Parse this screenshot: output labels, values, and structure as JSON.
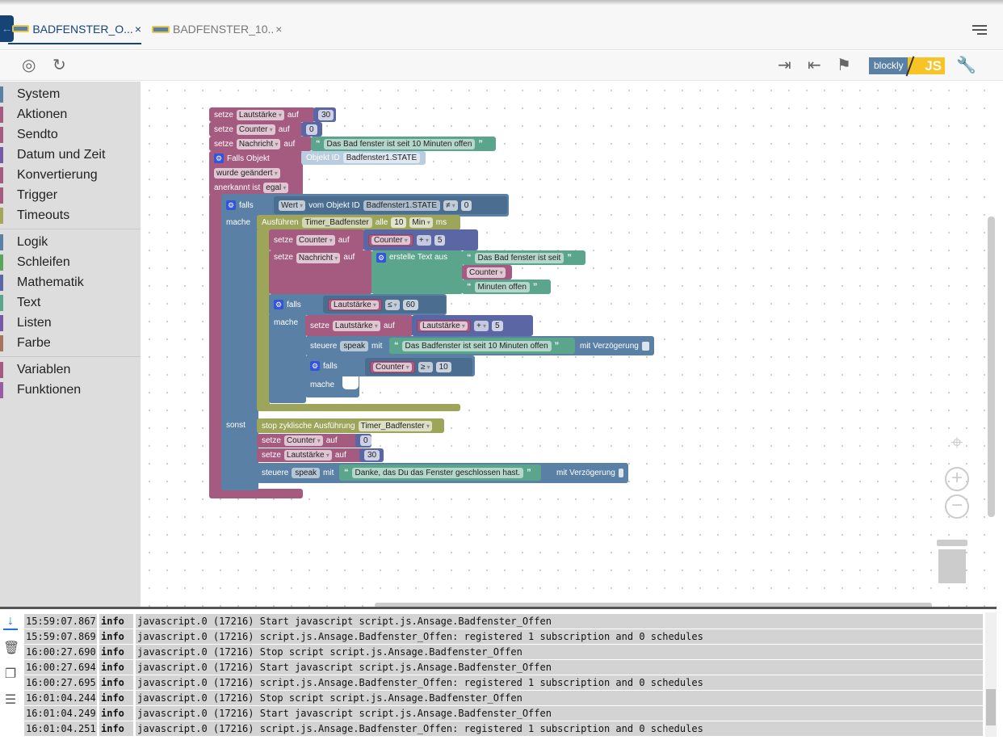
{
  "tabs": [
    {
      "label": "BADFENSTER_O...",
      "active": true
    },
    {
      "label": "BADFENSTER_10..",
      "active": false
    }
  ],
  "toolbar": {
    "logo_blockly": "blockly",
    "logo_js": "JS"
  },
  "sidebar": {
    "items": [
      {
        "label": "System",
        "color": "#5b80a5"
      },
      {
        "label": "Aktionen",
        "color": "#a55b80"
      },
      {
        "label": "Sendto",
        "color": "#a55b80"
      },
      {
        "label": "Datum und Zeit",
        "color": "#745ba5"
      },
      {
        "label": "Konvertierung",
        "color": "#a55b80"
      },
      {
        "label": "Trigger",
        "color": "#a55b80"
      },
      {
        "label": "Timeouts",
        "color": "#a5a55b"
      },
      {
        "label": "Logik",
        "color": "#5b80a5"
      },
      {
        "label": "Schleifen",
        "color": "#5ba55b"
      },
      {
        "label": "Mathematik",
        "color": "#5b67a5"
      },
      {
        "label": "Text",
        "color": "#5ba58c"
      },
      {
        "label": "Listen",
        "color": "#745ba5"
      },
      {
        "label": "Farbe",
        "color": "#a5745b"
      },
      {
        "label": "Variablen",
        "color": "#a55b80"
      },
      {
        "label": "Funktionen",
        "color": "#995ba5"
      }
    ]
  },
  "colors": {
    "variable": "#a55b80",
    "math": "#5b67a5",
    "text": "#5ba58c",
    "logic": "#5b80a5",
    "timer": "#9da55b",
    "object": "#b9cde0",
    "accent": "#164477"
  },
  "blocks": {
    "b1": [
      [
        "L",
        "setze"
      ],
      [
        "D",
        "Lautstärke"
      ],
      [
        "L",
        "auf"
      ]
    ],
    "b1v": [
      [
        "N",
        "30"
      ]
    ],
    "b2": [
      [
        "L",
        "setze"
      ],
      [
        "D",
        "Counter"
      ],
      [
        "L",
        "auf"
      ]
    ],
    "b2v": [
      [
        "N",
        "0"
      ]
    ],
    "b3": [
      [
        "L",
        "setze"
      ],
      [
        "D",
        "Nachricht"
      ],
      [
        "L",
        "auf"
      ]
    ],
    "b3v": [
      [
        "Q",
        "“"
      ],
      [
        "S",
        "Das Bad fenster ist seit 10 Minuten offen"
      ],
      [
        "Q",
        "”"
      ]
    ],
    "b4a": [
      [
        "G",
        "⚙"
      ],
      [
        "L",
        "Falls Objekt"
      ]
    ],
    "b4b": [
      [
        "D",
        "wurde geändert"
      ]
    ],
    "b4c": [
      [
        "L",
        "anerkannt ist"
      ],
      [
        "D",
        "egal"
      ]
    ],
    "b4obj": [
      [
        "L",
        "Objekt ID"
      ],
      [
        "S",
        "Badfenster1.STATE"
      ]
    ],
    "b5": [
      [
        "G",
        "⚙"
      ],
      [
        "L",
        "falls"
      ]
    ],
    "b5cond": [
      [
        "D",
        "Wert"
      ],
      [
        "L",
        "vom Objekt ID"
      ],
      [
        "S",
        "Badfenster1.STATE"
      ],
      [
        "D",
        "≠"
      ],
      [
        "N",
        "0"
      ]
    ],
    "b5m": [
      [
        "L",
        "mache"
      ]
    ],
    "b5s": [
      [
        "L",
        "sonst"
      ]
    ],
    "b6": [
      [
        "L",
        "Ausführen"
      ],
      [
        "S",
        "Timer_Badfenster"
      ],
      [
        "L",
        "alle"
      ],
      [
        "N",
        "10"
      ],
      [
        "D",
        "Min"
      ],
      [
        "L",
        "ms"
      ]
    ],
    "b7": [
      [
        "L",
        "setze"
      ],
      [
        "D",
        "Counter"
      ],
      [
        "L",
        "auf"
      ]
    ],
    "b7v": [
      [
        "V",
        "Counter"
      ],
      [
        "D",
        "+"
      ],
      [
        "N",
        "5"
      ]
    ],
    "b8": [
      [
        "L",
        "setze"
      ],
      [
        "D",
        "Nachricht"
      ],
      [
        "L",
        "auf"
      ]
    ],
    "b8v": [
      [
        "G",
        "⚙"
      ],
      [
        "L",
        "erstelle Text aus"
      ]
    ],
    "b8s1": [
      [
        "Q",
        "“"
      ],
      [
        "S",
        "Das Bad fenster ist seit"
      ],
      [
        "Q",
        "”"
      ]
    ],
    "b8s2": [
      [
        "D",
        "Counter"
      ]
    ],
    "b8s3": [
      [
        "Q",
        "“"
      ],
      [
        "S",
        "Minuten offen"
      ],
      [
        "Q",
        "”"
      ]
    ],
    "b9": [
      [
        "G",
        "⚙"
      ],
      [
        "L",
        "falls"
      ]
    ],
    "b9cond": [
      [
        "V",
        "Lautstärke"
      ],
      [
        "D",
        "≤"
      ],
      [
        "N",
        "60"
      ]
    ],
    "b9m": [
      [
        "L",
        "mache"
      ]
    ],
    "b10": [
      [
        "L",
        "setze"
      ],
      [
        "D",
        "Lautstärke"
      ],
      [
        "L",
        "auf"
      ]
    ],
    "b10v": [
      [
        "V",
        "Lautstärke"
      ],
      [
        "D",
        "+"
      ],
      [
        "N",
        "5"
      ]
    ],
    "b11": [
      [
        "L",
        "steuere"
      ],
      [
        "S",
        "speak"
      ],
      [
        "L",
        "mit"
      ]
    ],
    "b11t": [
      [
        "Q",
        "“"
      ],
      [
        "S",
        "Das Badfenster ist seit 10 Minuten offen"
      ],
      [
        "Q",
        "”"
      ]
    ],
    "b11m": [
      [
        "L",
        "mit Verzögerung"
      ],
      [
        "C",
        ""
      ]
    ],
    "b12": [
      [
        "G",
        "⚙"
      ],
      [
        "L",
        "falls"
      ]
    ],
    "b12cond": [
      [
        "V",
        "Counter"
      ],
      [
        "D",
        "≥"
      ],
      [
        "N",
        "10"
      ]
    ],
    "b12m": [
      [
        "L",
        "mache"
      ]
    ],
    "b13": [
      [
        "L",
        "stop zyklische Ausführung"
      ],
      [
        "D",
        "Timer_Badfenster"
      ]
    ],
    "b14": [
      [
        "L",
        "setze"
      ],
      [
        "D",
        "Counter"
      ],
      [
        "L",
        "auf"
      ]
    ],
    "b14v": [
      [
        "N",
        "0"
      ]
    ],
    "b15": [
      [
        "L",
        "setze"
      ],
      [
        "D",
        "Lautstärke"
      ],
      [
        "L",
        "auf"
      ]
    ],
    "b15v": [
      [
        "N",
        "30"
      ]
    ],
    "b16": [
      [
        "L",
        "steuere"
      ],
      [
        "S",
        "speak"
      ],
      [
        "L",
        "mit"
      ]
    ],
    "b16t": [
      [
        "Q",
        "“"
      ],
      [
        "S",
        "Danke, das Du das Fenster geschlossen hast."
      ],
      [
        "Q",
        "”"
      ]
    ],
    "b16m": [
      [
        "L",
        "mit Verzögerung"
      ],
      [
        "C",
        ""
      ]
    ]
  },
  "log": [
    {
      "time": "15:59:07.867",
      "level": "info",
      "msg": "javascript.0 (17216) Start javascript script.js.Ansage.Badfenster_Offen"
    },
    {
      "time": "15:59:07.869",
      "level": "info",
      "msg": "javascript.0 (17216) script.js.Ansage.Badfenster_Offen: registered 1 subscription and 0 schedules"
    },
    {
      "time": "16:00:27.690",
      "level": "info",
      "msg": "javascript.0 (17216) Stop script script.js.Ansage.Badfenster_Offen"
    },
    {
      "time": "16:00:27.694",
      "level": "info",
      "msg": "javascript.0 (17216) Start javascript script.js.Ansage.Badfenster_Offen"
    },
    {
      "time": "16:00:27.695",
      "level": "info",
      "msg": "javascript.0 (17216) script.js.Ansage.Badfenster_Offen: registered 1 subscription and 0 schedules"
    },
    {
      "time": "16:01:04.244",
      "level": "info",
      "msg": "javascript.0 (17216) Stop script script.js.Ansage.Badfenster_Offen"
    },
    {
      "time": "16:01:04.249",
      "level": "info",
      "msg": "javascript.0 (17216) Start javascript script.js.Ansage.Badfenster_Offen"
    },
    {
      "time": "16:01:04.251",
      "level": "info",
      "msg": "javascript.0 (17216) script.js.Ansage.Badfenster_Offen: registered 1 subscription and 0 schedules"
    }
  ]
}
